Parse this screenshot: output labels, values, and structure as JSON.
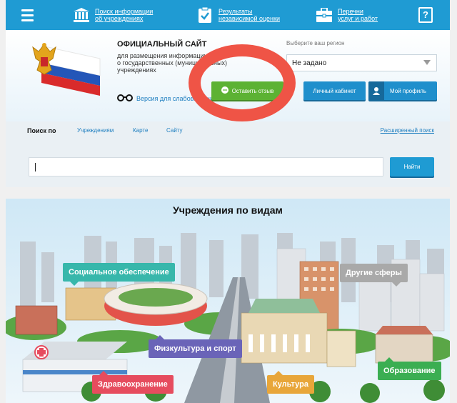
{
  "topnav": {
    "items": [
      {
        "label_line1": "Поиск информации",
        "label_line2": "об учреждениях",
        "icon": "building-icon"
      },
      {
        "label_line1": "Результаты",
        "label_line2": "независимой оценки",
        "icon": "checklist-icon"
      },
      {
        "label_line1": "Перечни",
        "label_line2": "услуг и работ",
        "icon": "briefcase-icon"
      }
    ],
    "help_label": "?"
  },
  "header": {
    "title": "ОФИЦИАЛЬНЫЙ САЙТ",
    "subtitle_lines": [
      "для размещения информации",
      "о государственных (муниципальных)",
      "учреждениях"
    ],
    "vision_label": "Версия для слабовидящих",
    "region_label": "Выберите ваш регион",
    "region_value": "Не задано",
    "feedback_button": "Оставить отзыв",
    "cabinet_button": "Личный кабинет",
    "profile_button": "Мой профиль"
  },
  "search": {
    "prefix": "Поиск по",
    "tabs": [
      "Учреждениям",
      "Карте",
      "Сайту"
    ],
    "advanced": "Расширенный поиск",
    "input_value": "",
    "find_button": "Найти"
  },
  "categories": {
    "title": "Учреждения по видам",
    "items": [
      {
        "label": "Социальное обеспечение",
        "color": "#37b7ab"
      },
      {
        "label": "Другие сферы",
        "color": "#a9a9a9"
      },
      {
        "label": "Физкультура и спорт",
        "color": "#6a64b8"
      },
      {
        "label": "Здравоохранение",
        "color": "#e64c5e"
      },
      {
        "label": "Культура",
        "color": "#e8a63a"
      },
      {
        "label": "Образование",
        "color": "#3bae52"
      }
    ]
  },
  "colors": {
    "nav": "#1f9bd3",
    "feedback": "#5cb233",
    "annotation": "#ef5446"
  }
}
